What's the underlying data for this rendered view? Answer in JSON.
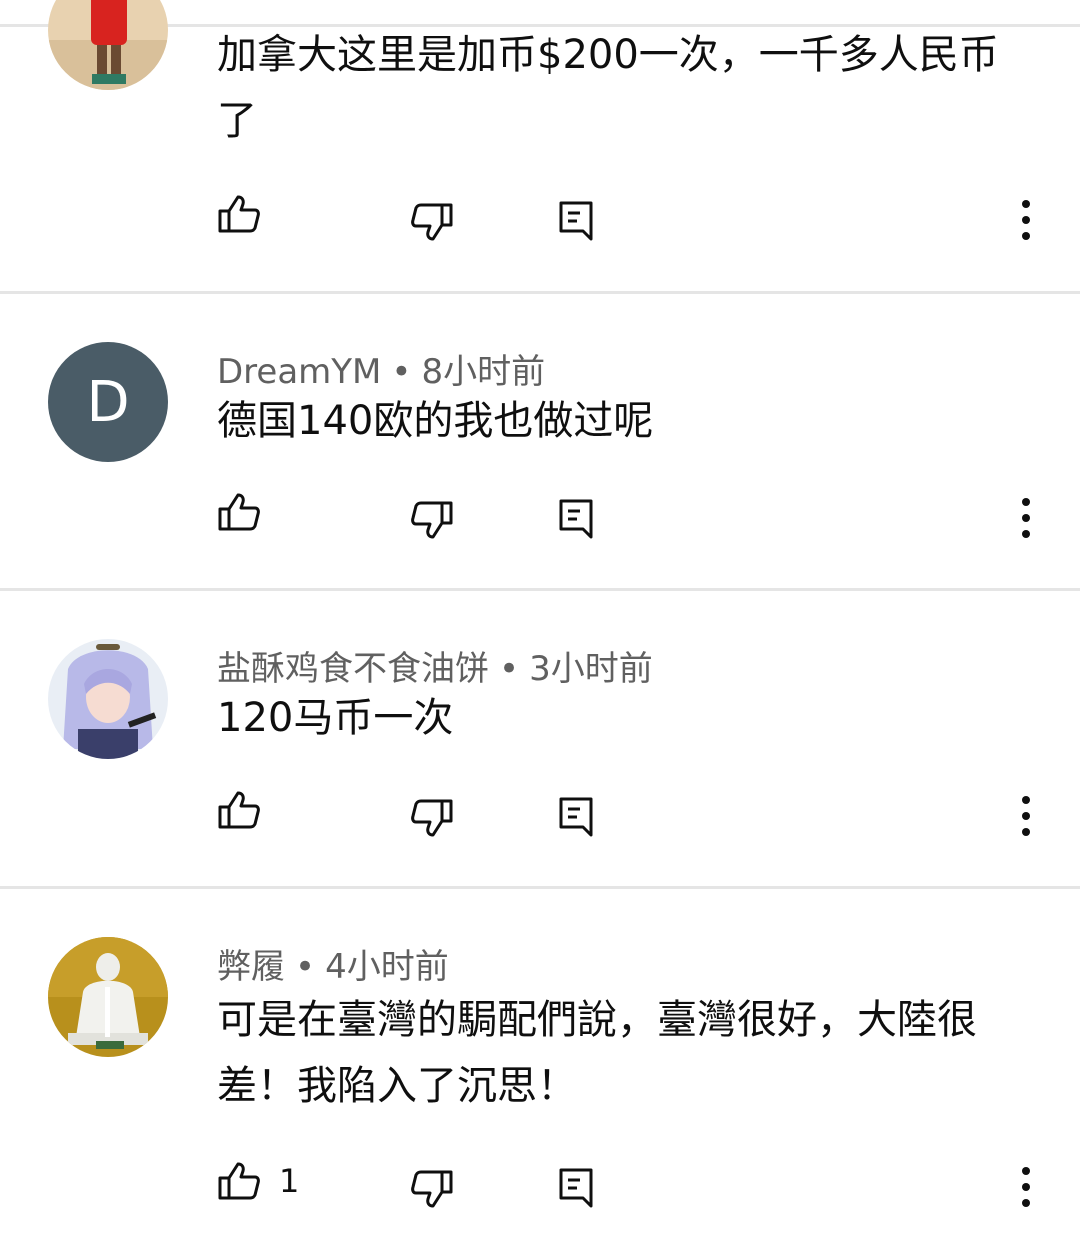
{
  "comments": [
    {
      "author": "",
      "time": "",
      "text": "加拿大这里是加币$200一次，一千多人民币了",
      "likes": "",
      "avatar_icon": "person-red-shirt-beach-avatar"
    },
    {
      "author": "DreamYM",
      "time": "8小时前",
      "text": "德国140欧的我也做过呢",
      "likes": "",
      "avatar_letter": "D",
      "avatar_color": "#4a5c67"
    },
    {
      "author": "盐酥鸡食不食油饼",
      "time": "3小时前",
      "text": "120马币一次",
      "likes": "",
      "avatar_icon": "cosplay-girl-avatar"
    },
    {
      "author": "弊履",
      "time": "4小时前",
      "text": "可是在臺灣的駶配們說，臺灣很好，大陸很差！我陷入了沉思！",
      "likes": "1",
      "avatar_icon": "statue-avatar"
    }
  ],
  "icons": {
    "like": "thumb-up-icon",
    "dislike": "thumb-down-icon",
    "reply": "reply-icon",
    "more": "more-vertical-icon"
  },
  "colors": {
    "meta_text": "#606060",
    "body_text": "#0f0f0f",
    "divider": "#e5e5e5"
  }
}
